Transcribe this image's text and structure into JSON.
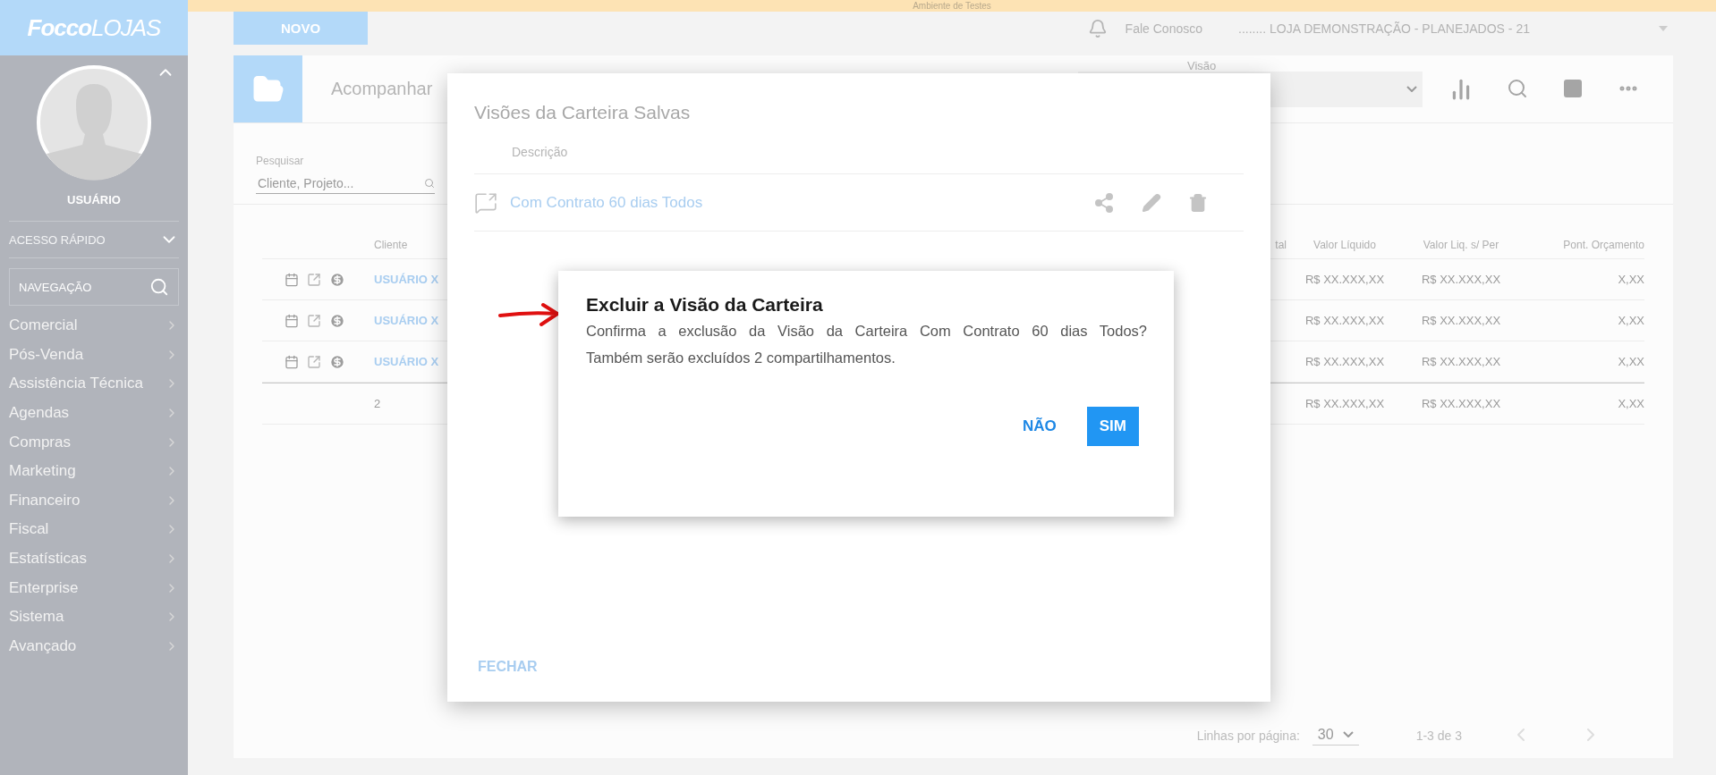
{
  "banner": "Ambiente de Testes",
  "sidebar": {
    "logo": {
      "bold": "Focco",
      "light": "LOJAS"
    },
    "user": "USUÁRIO",
    "quick_access": "ACESSO RÁPIDO",
    "nav_search": "NAVEGAÇÃO",
    "menu": [
      {
        "label": "Comercial"
      },
      {
        "label": "Pós-Venda"
      },
      {
        "label": "Assistência Técnica"
      },
      {
        "label": "Agendas"
      },
      {
        "label": "Compras"
      },
      {
        "label": "Marketing"
      },
      {
        "label": "Financeiro"
      },
      {
        "label": "Fiscal"
      },
      {
        "label": "Estatísticas"
      },
      {
        "label": "Enterprise"
      },
      {
        "label": "Sistema"
      },
      {
        "label": "Avançado"
      }
    ]
  },
  "header": {
    "new_button": "NOVO",
    "contact": "Fale Conosco",
    "store": "........ LOJA DEMONSTRAÇÃO - PLANEJADOS - 21"
  },
  "page": {
    "title": "Acompanhar",
    "view_label": "Visão",
    "search": {
      "label": "Pesquisar",
      "placeholder": "Cliente, Projeto..."
    }
  },
  "table": {
    "columns": [
      {
        "label": "Cliente"
      },
      {
        "label": "tal"
      },
      {
        "label": "Valor Líquido"
      },
      {
        "label": "Valor Liq. s/ Per"
      },
      {
        "label": "Pont. Orçamento"
      }
    ],
    "rows": [
      {
        "client": "USUÁRIO X",
        "values": [
          "R$ XX.XXX,XX",
          "R$ XX.XXX,XX",
          "X,XX"
        ]
      },
      {
        "client": "USUÁRIO X",
        "values": [
          "R$ XX.XXX,XX",
          "R$ XX.XXX,XX",
          "X,XX"
        ]
      },
      {
        "client": "USUÁRIO X",
        "values": [
          "R$ XX.XXX,XX",
          "R$ XX.XXX,XX",
          "X,XX"
        ]
      }
    ],
    "totals": {
      "count": "2",
      "values": [
        "R$ XX.XXX,XX",
        "R$ XX.XXX,XX",
        "X,XX"
      ]
    }
  },
  "pagination": {
    "label": "Linhas por página:",
    "per_page": "30",
    "range": "1-3 de 3"
  },
  "saved_views_dialog": {
    "title": "Visões da Carteira Salvas",
    "column": "Descrição",
    "views": [
      {
        "name": "Com Contrato 60 dias Todos"
      }
    ],
    "close": "FECHAR"
  },
  "confirm_dialog": {
    "title": "Excluir a Visão da Carteira",
    "message": "Confirma a exclusão da Visão da Carteira Com Contrato 60 dias Todos?",
    "note": "Também serão excluídos 2 compartilhamentos.",
    "buttons": [
      {
        "label": "NÃO",
        "kind": "text"
      },
      {
        "label": "SIM",
        "kind": "primary"
      }
    ]
  }
}
